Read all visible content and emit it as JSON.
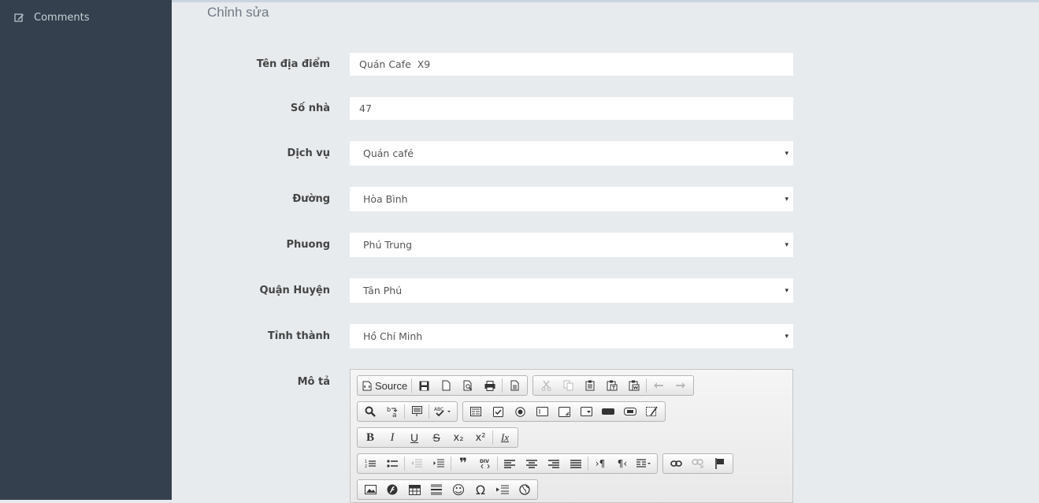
{
  "sidebar": {
    "items": [
      {
        "label": "Comments",
        "icon": "edit-icon"
      }
    ]
  },
  "page": {
    "title": "Chỉnh sửa"
  },
  "form": {
    "ten_dia_diem": {
      "label": "Tên địa điểm",
      "value": "Quán Cafe  X9"
    },
    "so_nha": {
      "label": "Số nhà",
      "value": "47"
    },
    "dich_vu": {
      "label": "Dịch vụ",
      "value": "Quán café"
    },
    "duong": {
      "label": "Đường",
      "value": "Hòa Bình"
    },
    "phuong": {
      "label": "Phuong",
      "value": "Phú Trung"
    },
    "quan_huyen": {
      "label": "Quận Huyện",
      "value": "Tân Phú"
    },
    "tinh_thanh": {
      "label": "Tỉnh thành",
      "value": "Hồ Chí Minh"
    },
    "mo_ta": {
      "label": "Mô tả"
    }
  },
  "editor": {
    "source_label": "Source",
    "glyphs": {
      "caret": "▾",
      "bold": "B",
      "italic": "I",
      "underline": "U",
      "strike": "S",
      "subscript": "x₂",
      "superscript": "x²",
      "remove_format": "Ix",
      "blockquote": "❞",
      "div": "DIV",
      "ltr": "›¶",
      "rtl": "¶‹",
      "omega": "Ω",
      "smiley": "☺",
      "spell": "ABC"
    }
  },
  "colors": {
    "sidebar": "#34404d",
    "background": "#e8ebee"
  }
}
